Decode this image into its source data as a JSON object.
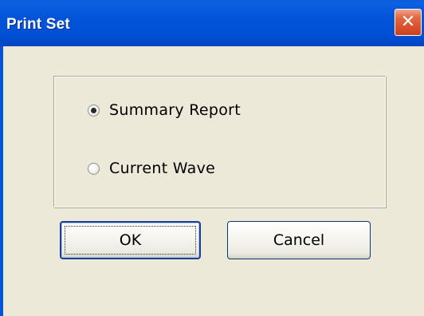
{
  "window": {
    "title": "Print Set",
    "close_glyph": "✕",
    "close_icon": "close-icon"
  },
  "options": {
    "group": [
      {
        "label": "Summary Report",
        "selected": true
      },
      {
        "label": "Current Wave",
        "selected": false
      }
    ]
  },
  "buttons": {
    "ok_label": "OK",
    "cancel_label": "Cancel"
  },
  "colors": {
    "title_bar": "#0453d8",
    "close_button": "#d9502b",
    "dialog_background": "#ece9d8"
  }
}
